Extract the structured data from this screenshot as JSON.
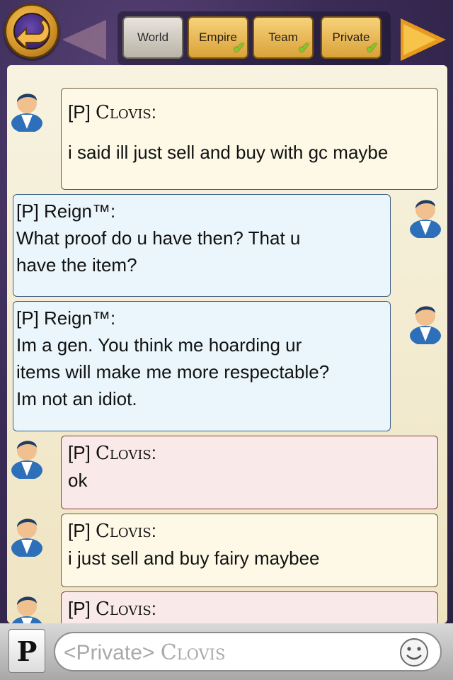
{
  "header": {
    "tabs": [
      {
        "label": "World",
        "checked": false
      },
      {
        "label": "Empire",
        "checked": true
      },
      {
        "label": "Team",
        "checked": true
      },
      {
        "label": "Private",
        "checked": true
      }
    ],
    "icons": {
      "back": "back-arrow-icon",
      "prev": "left-arrow-icon",
      "next": "right-arrow-icon"
    }
  },
  "messages": [
    {
      "side": "left",
      "style": "cream",
      "prefix": "[P]",
      "sender": "Clovis",
      "lines": [
        "i said ill just sell and buy with gc maybe"
      ]
    },
    {
      "side": "right",
      "style": "blue",
      "prefix": "[P]",
      "sender": "Reign™",
      "lines": [
        "What proof do u have then? That u",
        "have the item?"
      ]
    },
    {
      "side": "right",
      "style": "blue",
      "prefix": "[P]",
      "sender": "Reign™",
      "lines": [
        "Im a gen. You think me hoarding ur",
        "items will make me more respectable?",
        "Im not an idiot."
      ]
    },
    {
      "side": "left",
      "style": "pink",
      "prefix": "[P]",
      "sender": "Clovis",
      "lines": [
        "ok"
      ]
    },
    {
      "side": "left",
      "style": "cream",
      "prefix": "[P]",
      "sender": "Clovis",
      "lines": [
        "i just sell and buy fairy maybee"
      ]
    },
    {
      "side": "left",
      "style": "pink",
      "prefix": "[P]",
      "sender": "Clovis",
      "lines": []
    }
  ],
  "composer": {
    "channel_button": "P",
    "placeholder_channel": "<Private>",
    "placeholder_target": "Clovis",
    "emoji_icon": "smiley-icon"
  },
  "colors": {
    "cream": "#fdf9e6",
    "blue": "#eaf6fb",
    "pink": "#fae9e9",
    "accent_gold": "#d9a239",
    "check_green": "#7ccf2a"
  }
}
